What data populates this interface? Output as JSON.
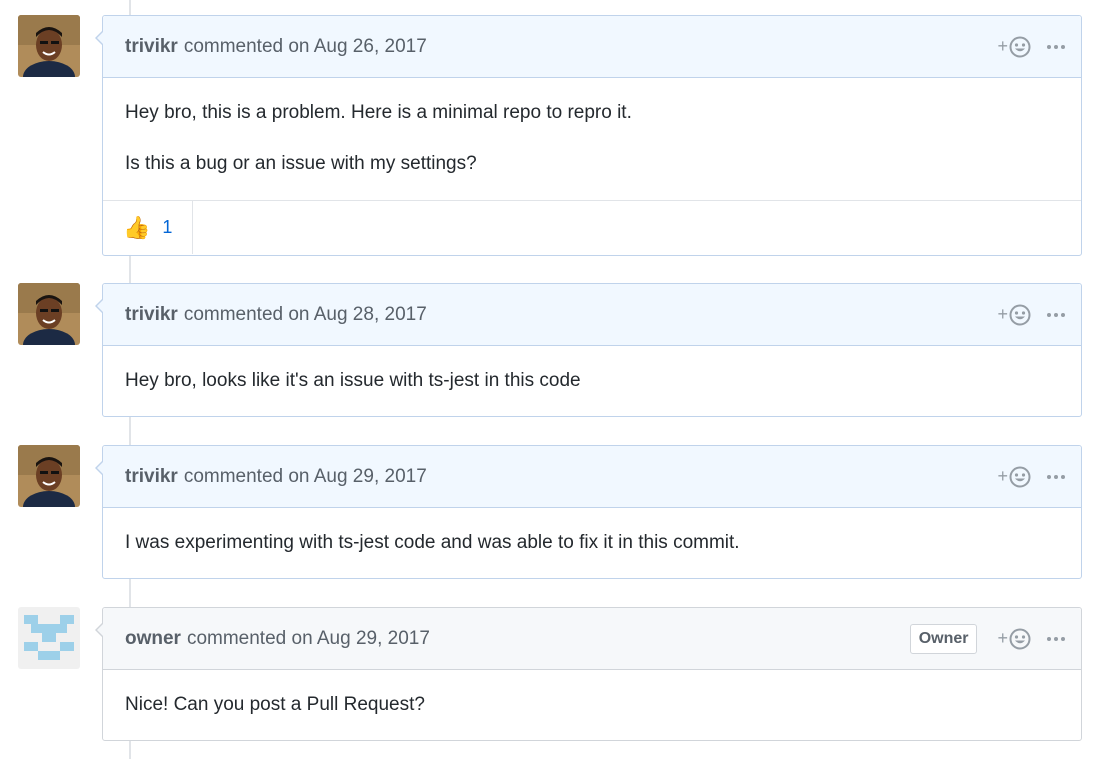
{
  "colors": {
    "header_bg": "#f1f8ff",
    "owner_header_bg": "#f6f8fa",
    "card_border": "#c0d3eb",
    "link_blue": "#0366d6",
    "muted_text": "#586069"
  },
  "comments": [
    {
      "author": "trivikr",
      "meta": "commented on Aug 26, 2017",
      "paragraphs": [
        "Hey bro, this is a problem. Here is a minimal repo to repro it.",
        "Is this a bug or an issue with my settings?"
      ],
      "reactions": [
        {
          "icon": "thumbs-up-icon",
          "emoji": "👍",
          "count": "1"
        }
      ]
    },
    {
      "author": "trivikr",
      "meta": "commented on Aug 28, 2017",
      "paragraphs": [
        "Hey bro, looks like it's an issue with ts-jest in this code"
      ]
    },
    {
      "author": "trivikr",
      "meta": "commented on Aug 29, 2017",
      "paragraphs": [
        "I was experimenting with ts-jest code and was able to fix it in this commit."
      ]
    },
    {
      "author": "owner",
      "meta": "commented on Aug 29, 2017",
      "badge": "Owner",
      "paragraphs": [
        "Nice! Can you post a Pull Request?"
      ]
    }
  ],
  "icons": {
    "add_reaction": "smiley-icon",
    "more_actions": "kebab-horizontal-icon"
  },
  "labels": {
    "add_reaction_plus": "+"
  }
}
